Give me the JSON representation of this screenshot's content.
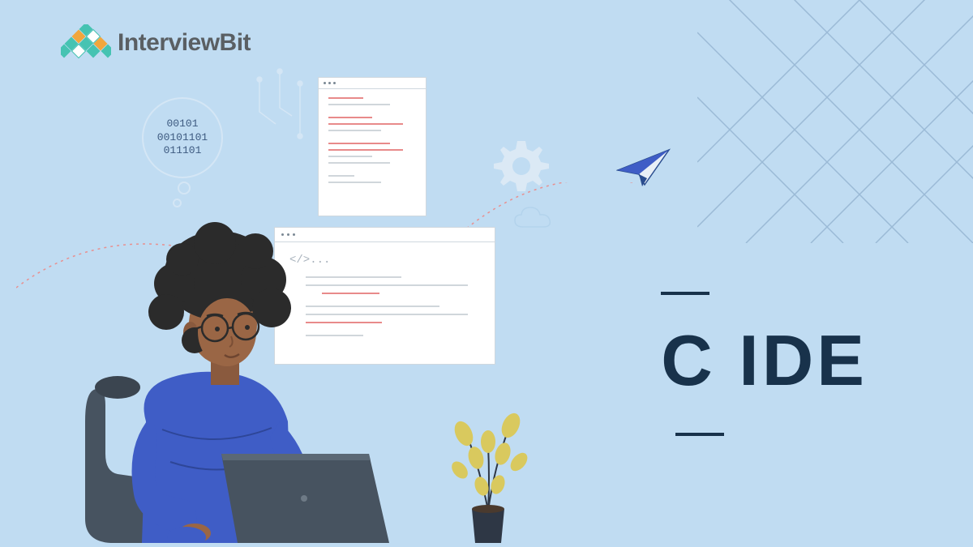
{
  "logo": {
    "text": "InterviewBit"
  },
  "binary": {
    "line1": "00101",
    "line2": "00101101",
    "line3": "011101"
  },
  "title": "C  IDE",
  "code_tag": "</>...",
  "colors": {
    "bg": "#c0dcf2",
    "title": "#18324b",
    "accent_blue": "#3f5dc6",
    "accent_teal": "#46c3b2",
    "accent_orange": "#f2a63c"
  }
}
